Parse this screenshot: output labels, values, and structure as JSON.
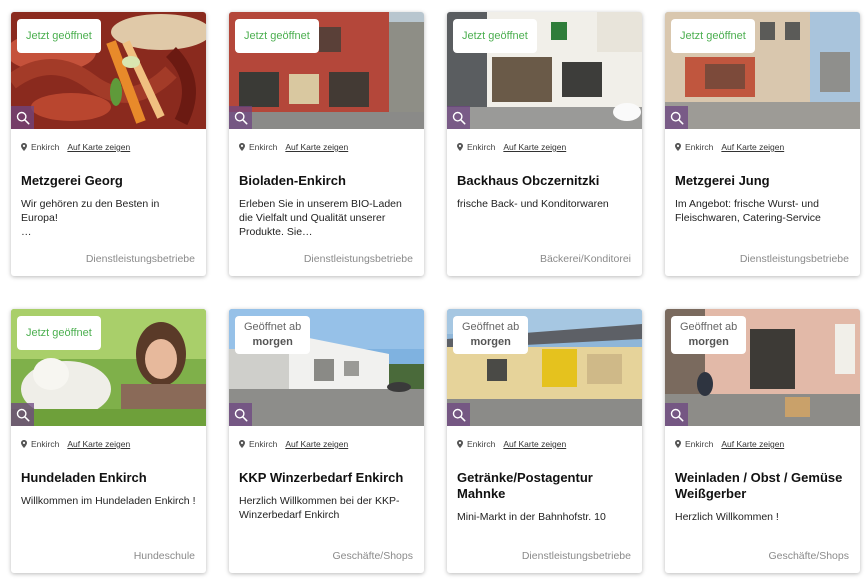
{
  "cards": [
    {
      "badge_open": "Jetzt geöffnet",
      "town": "Enkirch",
      "map_link": "Auf Karte zeigen",
      "title": "Metzgerei Georg",
      "description": "Wir gehören zu den Besten in Europa!\n…",
      "category": "Dienstleistungsbetriebe"
    },
    {
      "badge_open": "Jetzt geöffnet",
      "town": "Enkirch",
      "map_link": "Auf Karte zeigen",
      "title": "Bioladen-Enkirch",
      "description": "Erleben Sie in unserem BIO-Laden die Vielfalt und Qualität unserer Produkte. Sie…",
      "category": "Dienstleistungsbetriebe"
    },
    {
      "badge_open": "Jetzt geöffnet",
      "town": "Enkirch",
      "map_link": "Auf Karte zeigen",
      "title": "Backhaus Obczernitzki",
      "description": "frische Back- und Konditorwaren",
      "category": "Bäckerei/Konditorei"
    },
    {
      "badge_open": "Jetzt geöffnet",
      "town": "Enkirch",
      "map_link": "Auf Karte zeigen",
      "title": "Metzgerei Jung",
      "description": "Im Angebot: frische Wurst- und Fleischwaren, Catering-Service",
      "category": "Dienstleistungsbetriebe"
    },
    {
      "badge_open": "Jetzt geöffnet",
      "town": "Enkirch",
      "map_link": "Auf Karte zeigen",
      "title": "Hundeladen Enkirch",
      "description": "Willkommen im Hundeladen Enkirch !",
      "category": "Hundeschule"
    },
    {
      "badge_line1": "Geöffnet ab",
      "badge_line2": "morgen",
      "town": "Enkirch",
      "map_link": "Auf Karte zeigen",
      "title": "KKP Winzerbedarf Enkirch",
      "description": "Herzlich Willkommen bei der KKP-Winzerbedarf Enkirch",
      "category": "Geschäfte/Shops"
    },
    {
      "badge_line1": "Geöffnet ab",
      "badge_line2": "morgen",
      "town": "Enkirch",
      "map_link": "Auf Karte zeigen",
      "title": "Getränke/Postagentur Mahnke",
      "description": "Mini-Markt in der Bahnhofstr. 10",
      "category": "Dienstleistungsbetriebe"
    },
    {
      "badge_line1": "Geöffnet ab",
      "badge_line2": "morgen",
      "town": "Enkirch",
      "map_link": "Auf Karte zeigen",
      "title": "Weinladen / Obst / Gemüse Weißgerber",
      "description": "Herzlich Willkommen !",
      "category": "Geschäfte/Shops"
    }
  ],
  "colors": {
    "open_green": "#4caf50",
    "zoom_overlay": "#6e4682",
    "category_gray": "#8a8a8a"
  },
  "icons": {
    "zoom": "magnifier-icon",
    "location": "map-pin-icon"
  }
}
